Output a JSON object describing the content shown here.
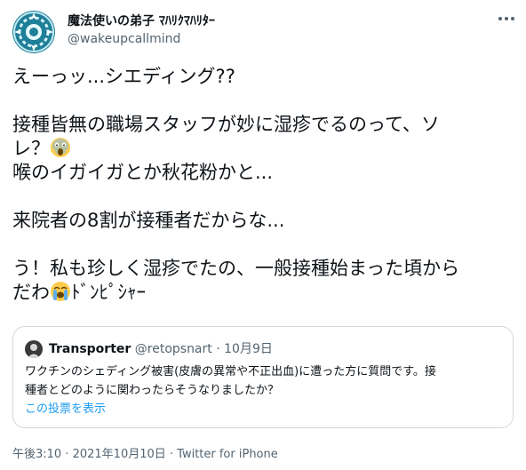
{
  "user": {
    "display_name": "魔法使いの弟子 ﾏﾊﾘｸﾏﾊﾘﾀｰ",
    "handle": "@wakeupcallmind",
    "avatar_icon": "patterned-avatar-icon",
    "avatar_color": "#2b8fa8"
  },
  "tweet": {
    "lines": [
      "えーっッ...シエディング??",
      "",
      "接種皆無の職場スタッフが妙に湿疹でるのって、ソ",
      "レ？",
      "喉のイガイガとか秋花粉かと...",
      "",
      "来院者の8割が接種者だからな...",
      "",
      "う！私も珍しく湿疹でたの、一般接種始まった頃から",
      "だわ"
    ],
    "line4_emoji": "screaming-face-emoji",
    "line10_emoji": "crying-face-emoji",
    "line10_suffix": "ﾄﾞﾝﾋﾟｼｬｰ"
  },
  "quote": {
    "name": "Transporter",
    "handle": "@retopsnart",
    "separator": "·",
    "date": "10月9日",
    "body_lines": [
      "ワクチンのシェディング被害(皮膚の異常や不正出血)に遭った方に質問です。接",
      "種者とどのように関わったらそうなりましたか？"
    ],
    "link_text": "この投票を表示"
  },
  "meta": {
    "timestamp": "午後3:10 · 2021年10月10日 · Twitter for iPhone"
  },
  "colors": {
    "text": "#0f1419",
    "secondary": "#536471",
    "link": "#1d9bf0",
    "border": "#cfd9de"
  }
}
